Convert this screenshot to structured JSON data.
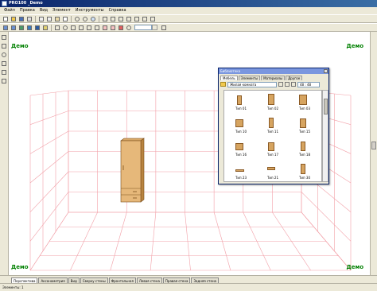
{
  "window": {
    "title": "PRO100 _Demo"
  },
  "menu": [
    "Файл",
    "Правка",
    "Вид",
    "Элемент",
    "Инструменты",
    "Справка"
  ],
  "toolbar": {
    "zoom_value": ""
  },
  "canvas": {
    "demo_labels": {
      "top_left": "Демо",
      "top_right": "Демо",
      "bottom_left": "Демо",
      "bottom_right": "Демо"
    }
  },
  "library": {
    "title": "Библиотека",
    "tabs": [
      "Мебель",
      "Элементы",
      "Материалы",
      "Другое"
    ],
    "folder": "Жилая комната",
    "size": "48 : 48",
    "items": [
      "Тип 01",
      "Тип 02",
      "Тип 03",
      "Тип 10",
      "Тип 11",
      "Тип 15",
      "Тип 16",
      "Тип 17",
      "Тип 18",
      "Тип 23",
      "Тип 21",
      "Тип 30"
    ]
  },
  "bottom_tabs": [
    "Перспектива",
    "Аксонометрия",
    "Вид",
    "Сверху стены",
    "Фронтальная",
    "Левая стена",
    "Правая стена",
    "Задняя стена"
  ],
  "status": {
    "text": "Элементы: 1"
  },
  "colors": {
    "grid": "#f2a0a8",
    "demo": "#008000",
    "wardrobe": "#e6b87a"
  }
}
